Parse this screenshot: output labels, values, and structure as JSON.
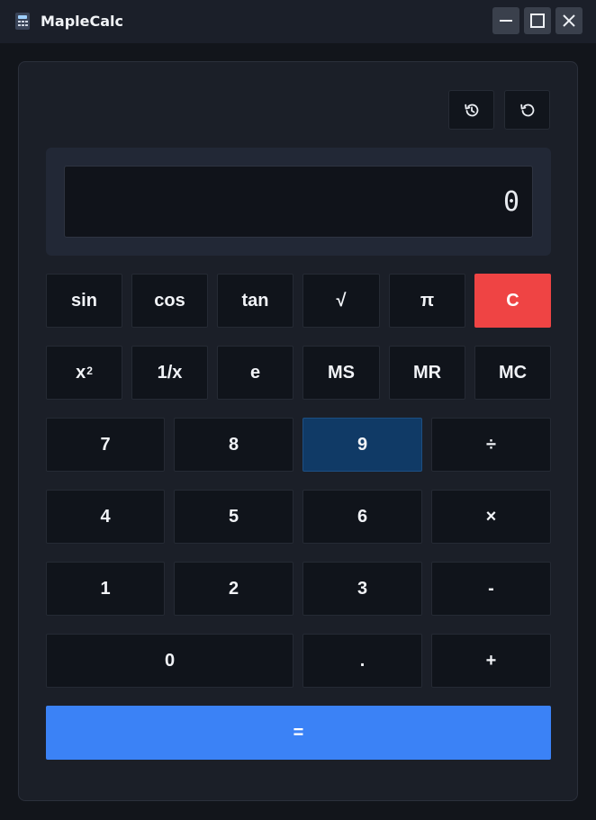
{
  "window": {
    "title": "MapleCalc",
    "controls": [
      "minimize-icon",
      "maximize-icon",
      "close-icon"
    ]
  },
  "toolbar": {
    "history_icon": "history-icon",
    "reset_icon": "reset-icon"
  },
  "display": {
    "value": "0"
  },
  "keys": {
    "sci_row1": [
      "sin",
      "cos",
      "tan",
      "√",
      "π",
      "C"
    ],
    "sci_row2": [
      "x",
      "1/x",
      "e",
      "MS",
      "MR",
      "MC"
    ],
    "sq_superscript": "2",
    "num_row1": [
      "7",
      "8",
      "9",
      "÷"
    ],
    "num_row2": [
      "4",
      "5",
      "6",
      "×"
    ],
    "num_row3": [
      "1",
      "2",
      "3",
      "-"
    ],
    "num_row4": [
      "0",
      ".",
      "+"
    ],
    "equals": "="
  },
  "colors": {
    "clear": "#ef4444",
    "equals": "#3b82f6",
    "active_key": "#103a66"
  }
}
